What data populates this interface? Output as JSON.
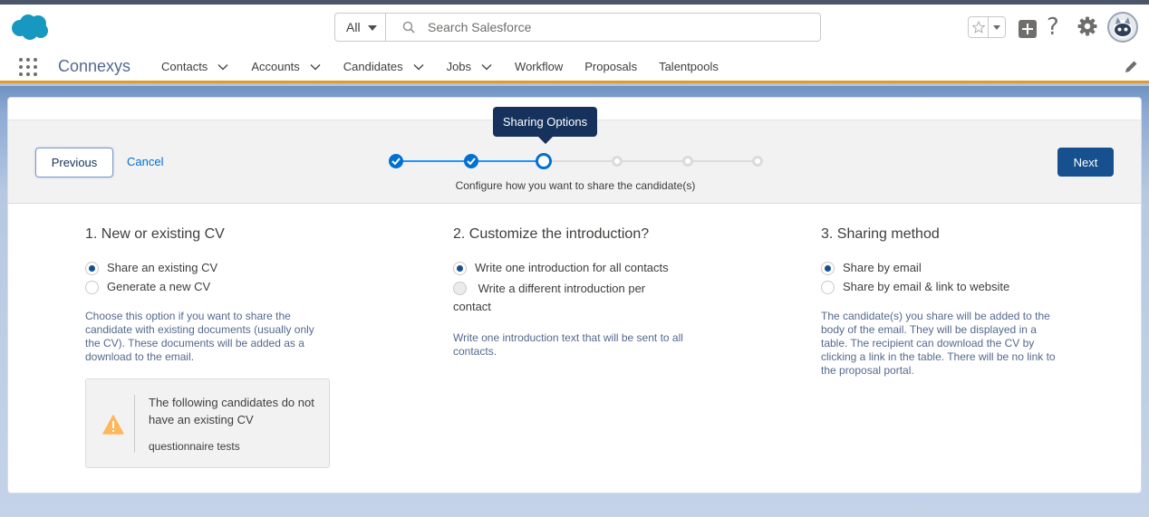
{
  "header": {
    "search_scope": "All",
    "search_placeholder": "Search Salesforce"
  },
  "nav": {
    "app_name": "Connexys",
    "items": [
      {
        "label": "Contacts",
        "has_menu": true
      },
      {
        "label": "Accounts",
        "has_menu": true
      },
      {
        "label": "Candidates",
        "has_menu": true
      },
      {
        "label": "Jobs",
        "has_menu": true
      },
      {
        "label": "Workflow",
        "has_menu": false
      },
      {
        "label": "Proposals",
        "has_menu": false
      },
      {
        "label": "Talentpools",
        "has_menu": false
      }
    ]
  },
  "wizard": {
    "previous_label": "Previous",
    "cancel_label": "Cancel",
    "next_label": "Next",
    "tooltip": "Sharing Options",
    "caption": "Configure how you want to share the candidate(s)",
    "steps": [
      "done",
      "done",
      "current",
      "todo",
      "todo",
      "todo"
    ]
  },
  "section1": {
    "title": "1. New or existing CV",
    "option_a": "Share an existing CV",
    "option_b": "Generate a new CV",
    "selected": "option_a",
    "help": "Choose this option if you want to share the candidate with existing documents (usually only the CV). These documents will be added as a download to the email.",
    "warning_message": "The following candidates do not have an existing CV",
    "warning_item": "questionnaire tests"
  },
  "section2": {
    "title": "2. Customize the introduction?",
    "option_a": "Write one introduction for all contacts",
    "option_b": "Write a different introduction per contact",
    "selected": "option_a",
    "help": "Write one introduction text that will be sent to all contacts."
  },
  "section3": {
    "title": "3. Sharing method",
    "option_a": "Share by email",
    "option_b": "Share by email & link to website",
    "selected": "option_a",
    "help": "The candidate(s) you share will be added to the body of the email. They will be displayed in a table. The recipient can download the CV by clicking a link in the table. There will be no link to the proposal portal."
  },
  "colors": {
    "brand": "#16508f",
    "link": "#0070d2",
    "nav_underline": "#e09a2e",
    "warning": "#ffb75d"
  }
}
